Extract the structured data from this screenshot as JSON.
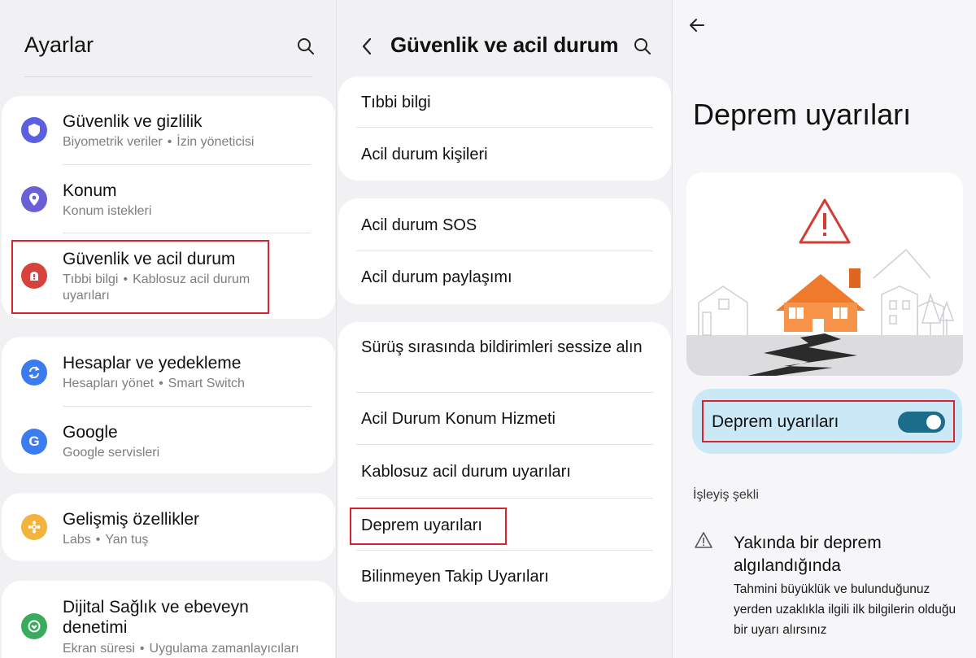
{
  "settings": {
    "title": "Ayarlar",
    "items": [
      {
        "title": "Güvenlik ve gizlilik",
        "sub1": "Biyometrik veriler",
        "sub2": "İzin yöneticisi"
      },
      {
        "title": "Konum",
        "sub1": "Konum istekleri"
      },
      {
        "title": "Güvenlik ve acil durum",
        "sub1": "Tıbbi bilgi",
        "sub2": "Kablosuz acil durum",
        "sub3": "uyarıları"
      },
      {
        "title": "Hesaplar ve yedekleme",
        "sub1": "Hesapları yönet",
        "sub2": "Smart Switch"
      },
      {
        "title": "Google",
        "sub1": "Google servisleri"
      },
      {
        "title": "Gelişmiş özellikler",
        "sub1": "Labs",
        "sub2": "Yan tuş"
      },
      {
        "title1": "Dijital Sağlık ve ebeveyn",
        "title2": "denetimi",
        "sub1": "Ekran süresi",
        "sub2": "Uygulama zamanlayıcıları"
      }
    ],
    "colors": {
      "shield": "#5b5fe0",
      "location": "#6a5fd6",
      "emergency": "#d8423c",
      "accounts": "#3a7bf1",
      "google": "#3b7cf0",
      "advanced": "#f3b33c",
      "wellbeing": "#3aaa5c"
    }
  },
  "safety": {
    "title": "Güvenlik ve acil durum",
    "items": [
      "Tıbbi bilgi",
      "Acil durum kişileri",
      "Acil durum SOS",
      "Acil durum paylaşımı",
      "Sürüş sırasında bildirimleri sessize alın",
      "Acil Durum Konum Hizmeti",
      "Kablosuz acil durum uyarıları",
      "Deprem uyarıları",
      "Bilinmeyen Takip Uyarıları"
    ]
  },
  "earthquake": {
    "title": "Deprem uyarıları",
    "toggle_label": "Deprem uyarıları",
    "toggle_on": true,
    "section_label": "İşleyiş şekli",
    "info_title": "Yakında bir deprem algılandığında",
    "info_body": "Tahmini büyüklük ve bulunduğunuz yerden uzaklıkla ilgili ilk bilgilerin olduğu bir uyarı alırsınız"
  }
}
